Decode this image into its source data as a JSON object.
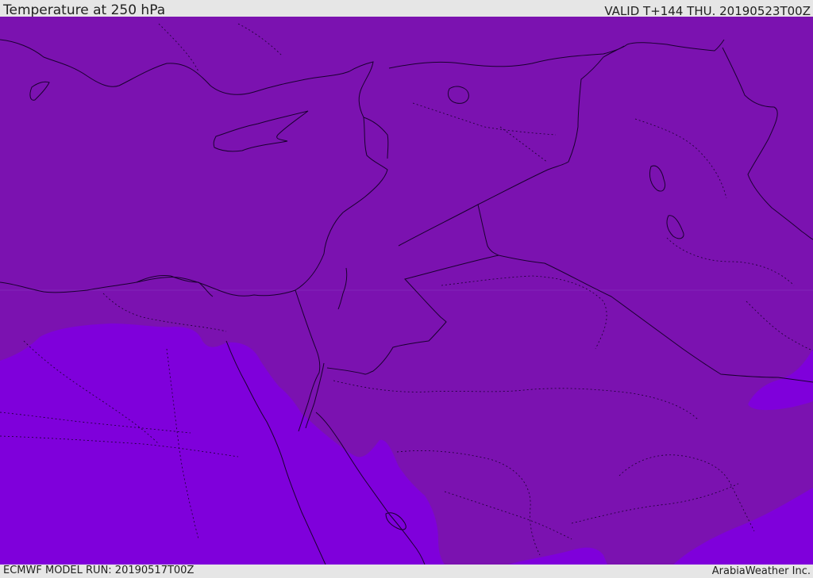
{
  "header": {
    "title": "Temperature at 250 hPa",
    "valid_time": "VALID T+144 THU. 20190523T00Z"
  },
  "footer": {
    "model_run": "ECMWF MODEL RUN: 20190517T00Z",
    "credit": "ArabiaWeather Inc."
  },
  "map": {
    "field": "temperature",
    "pressure_level_hpa": 250,
    "region": "Eastern Mediterranean and Middle East",
    "fill_colors": {
      "warmer_band": "#7b12b0",
      "colder_band": "#7f00db"
    },
    "coastline_color": "#1a0030",
    "border_style": "dotted"
  }
}
